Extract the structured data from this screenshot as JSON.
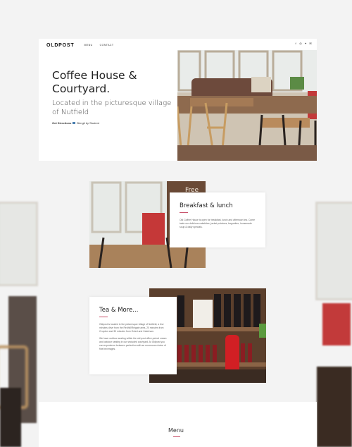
{
  "header": {
    "logo": "OLDPOST",
    "nav": [
      "MENU",
      "CONTACT"
    ],
    "social_icons": [
      "facebook-icon",
      "instagram-icon",
      "twitter-icon",
      "email-icon"
    ]
  },
  "hero": {
    "title": "Coffee House & Courtyard.",
    "subtitle": "Located in the picturesque village of Nutfield",
    "directions_label": "Get Directions",
    "directions_link": "Bringit by Student"
  },
  "sections": [
    {
      "title": "Breakfast & lunch",
      "text": "Old Coffee House is open for breakfast, lunch and afternoon tea. Come taste our delicious cakebites, jacket potatoes, baguettes, homemade soup & daily specials."
    },
    {
      "title": "Tea & More...",
      "text_1": "Oldpost is located in the picturesque village of Nutfield, a few minutes drive from the Redhill/Reigate area, 20 minutes from Croydon and 30 minutes from Oxted and Caterham.",
      "text_2": "We have outdoor seating within the old post office period cream and outdoor seating in our secluded courtyard. At Oldpost you can experience between perfection with an enormous choice of fine beverages."
    }
  ],
  "footer_section": {
    "title": "Menu"
  },
  "colors": {
    "accent": "#c8526a",
    "background": "#f3f3f3"
  }
}
